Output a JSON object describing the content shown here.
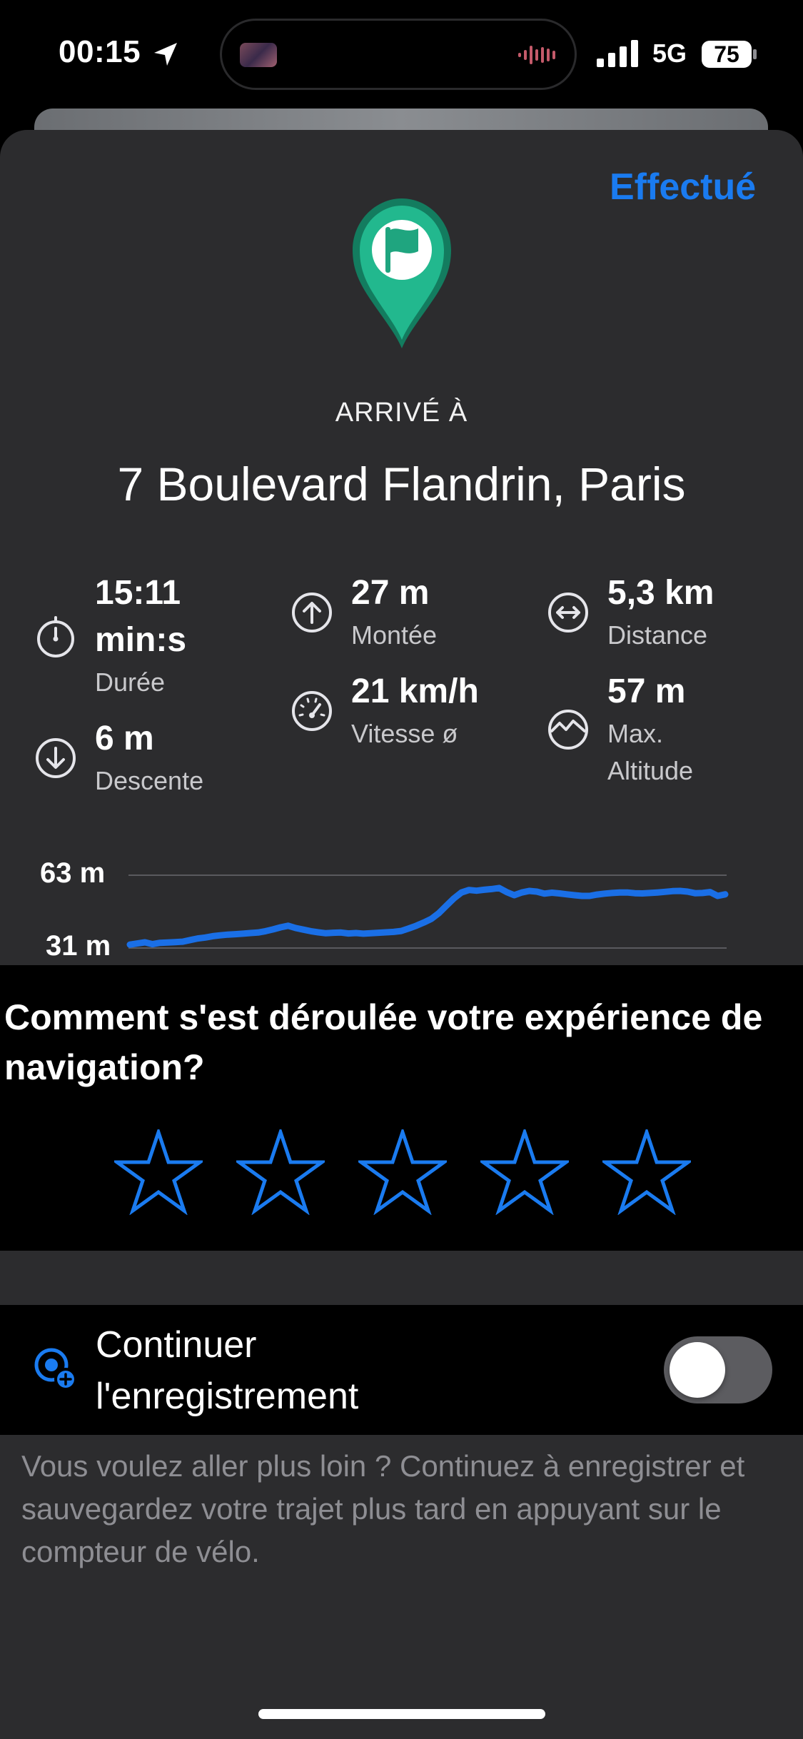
{
  "status_bar": {
    "time": "00:15",
    "network": "5G",
    "battery_level": "75"
  },
  "header": {
    "done_label": "Effectué"
  },
  "arrival": {
    "label": "ARRIVÉ À",
    "address": "7 Boulevard Flandrin, Paris"
  },
  "stats": {
    "duration": {
      "value_line1": "15:11",
      "value_line2": "min:s",
      "label": "Durée",
      "icon": "stopwatch-icon"
    },
    "descent": {
      "value": "6 m",
      "label": "Descente",
      "icon": "arrow-down-circle-icon"
    },
    "ascent": {
      "value": "27 m",
      "label": "Montée",
      "icon": "arrow-up-circle-icon"
    },
    "speed": {
      "value": "21 km/h",
      "label": "Vitesse ø",
      "icon": "speedometer-icon"
    },
    "distance": {
      "value": "5,3 km",
      "label": "Distance",
      "icon": "arrows-horizontal-circle-icon"
    },
    "altitude": {
      "value": "57 m",
      "label_line1": "Max.",
      "label_line2": "Altitude",
      "icon": "mountain-circle-icon"
    }
  },
  "chart_data": {
    "type": "line",
    "title": "",
    "xlabel": "",
    "ylabel": "",
    "ylim": [
      31,
      63
    ],
    "y_ticks": [
      "63 m",
      "31 m"
    ],
    "grid": true,
    "legend": "none",
    "color": "#1a6fe6",
    "series": [
      {
        "values": [
          32.5,
          33,
          33.5,
          32.7,
          33.3,
          33.4,
          33.6,
          33.8,
          34.5,
          35.2,
          35.6,
          36.2,
          36.6,
          36.9,
          37.1,
          37.3,
          37.6,
          37.8,
          38.4,
          39.2,
          40.1,
          40.8,
          39.8,
          39.1,
          38.4,
          37.9,
          37.5,
          37.7,
          37.8,
          37.4,
          37.6,
          37.3,
          37.5,
          37.7,
          37.9,
          38.1,
          38.5,
          39.6,
          40.8,
          42.2,
          43.8,
          46.3,
          49.6,
          52.8,
          55.4,
          56.5,
          56.2,
          56.6,
          56.9,
          57.4,
          55.6,
          54.2,
          55.4,
          56.1,
          55.8,
          54.9,
          55.3,
          55.0,
          54.6,
          54.2,
          53.9,
          53.9,
          54.5,
          54.9,
          55.2,
          55.4,
          55.4,
          55.1,
          55.0,
          55.2,
          55.4,
          55.7,
          56.0,
          56.1,
          55.8,
          55.1,
          55.2,
          55.6,
          53.9,
          54.6
        ]
      }
    ]
  },
  "rating": {
    "question": "Comment s'est déroulée votre expérience de navigation?",
    "max_stars": 5,
    "selected": 0
  },
  "recording": {
    "label_line1": "Continuer",
    "label_line2": "l'enregistrement",
    "enabled": false,
    "help_text": "Vous voulez aller plus loin ? Continuez à enregistrer et sauvegardez votre trajet plus tard en appuyant sur le compteur de vélo."
  },
  "colors": {
    "accent": "#1a7bf0",
    "pin": "#1fae8a",
    "sheet": "#2c2c2e"
  }
}
